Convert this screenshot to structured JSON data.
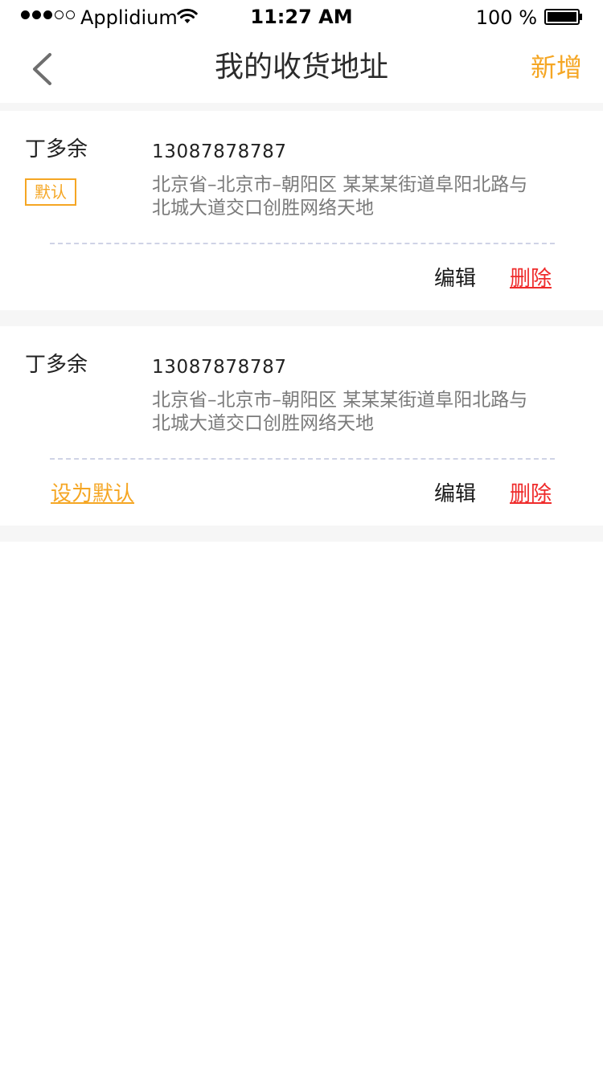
{
  "status_bar": {
    "carrier": "Applidium",
    "time": "11:27 AM",
    "battery": "100 %",
    "signal_icon": "signal-dots-icon",
    "wifi_icon": "wifi-icon",
    "battery_icon": "battery-full-icon"
  },
  "nav": {
    "back_icon": "chevron-left-icon",
    "title": "我的收货地址",
    "add_label": "新增"
  },
  "addresses": [
    {
      "name": "丁多余",
      "phone": "13087878787",
      "address": "北京省–北京市–朝阳区 某某某街道阜阳北路与北城大道交口创胜网络天地",
      "is_default": true,
      "default_badge": "默认",
      "edit_label": "编辑",
      "delete_label": "删除"
    },
    {
      "name": "丁多余",
      "phone": "13087878787",
      "address": "北京省–北京市–朝阳区 某某某街道阜阳北路与北城大道交口创胜网络天地",
      "is_default": false,
      "set_default_label": "设为默认",
      "edit_label": "编辑",
      "delete_label": "删除"
    }
  ],
  "colors": {
    "accent": "#f5a623",
    "delete": "#ef2b2b",
    "divider": "#cfd3e6",
    "background": "#f6f6f6"
  }
}
